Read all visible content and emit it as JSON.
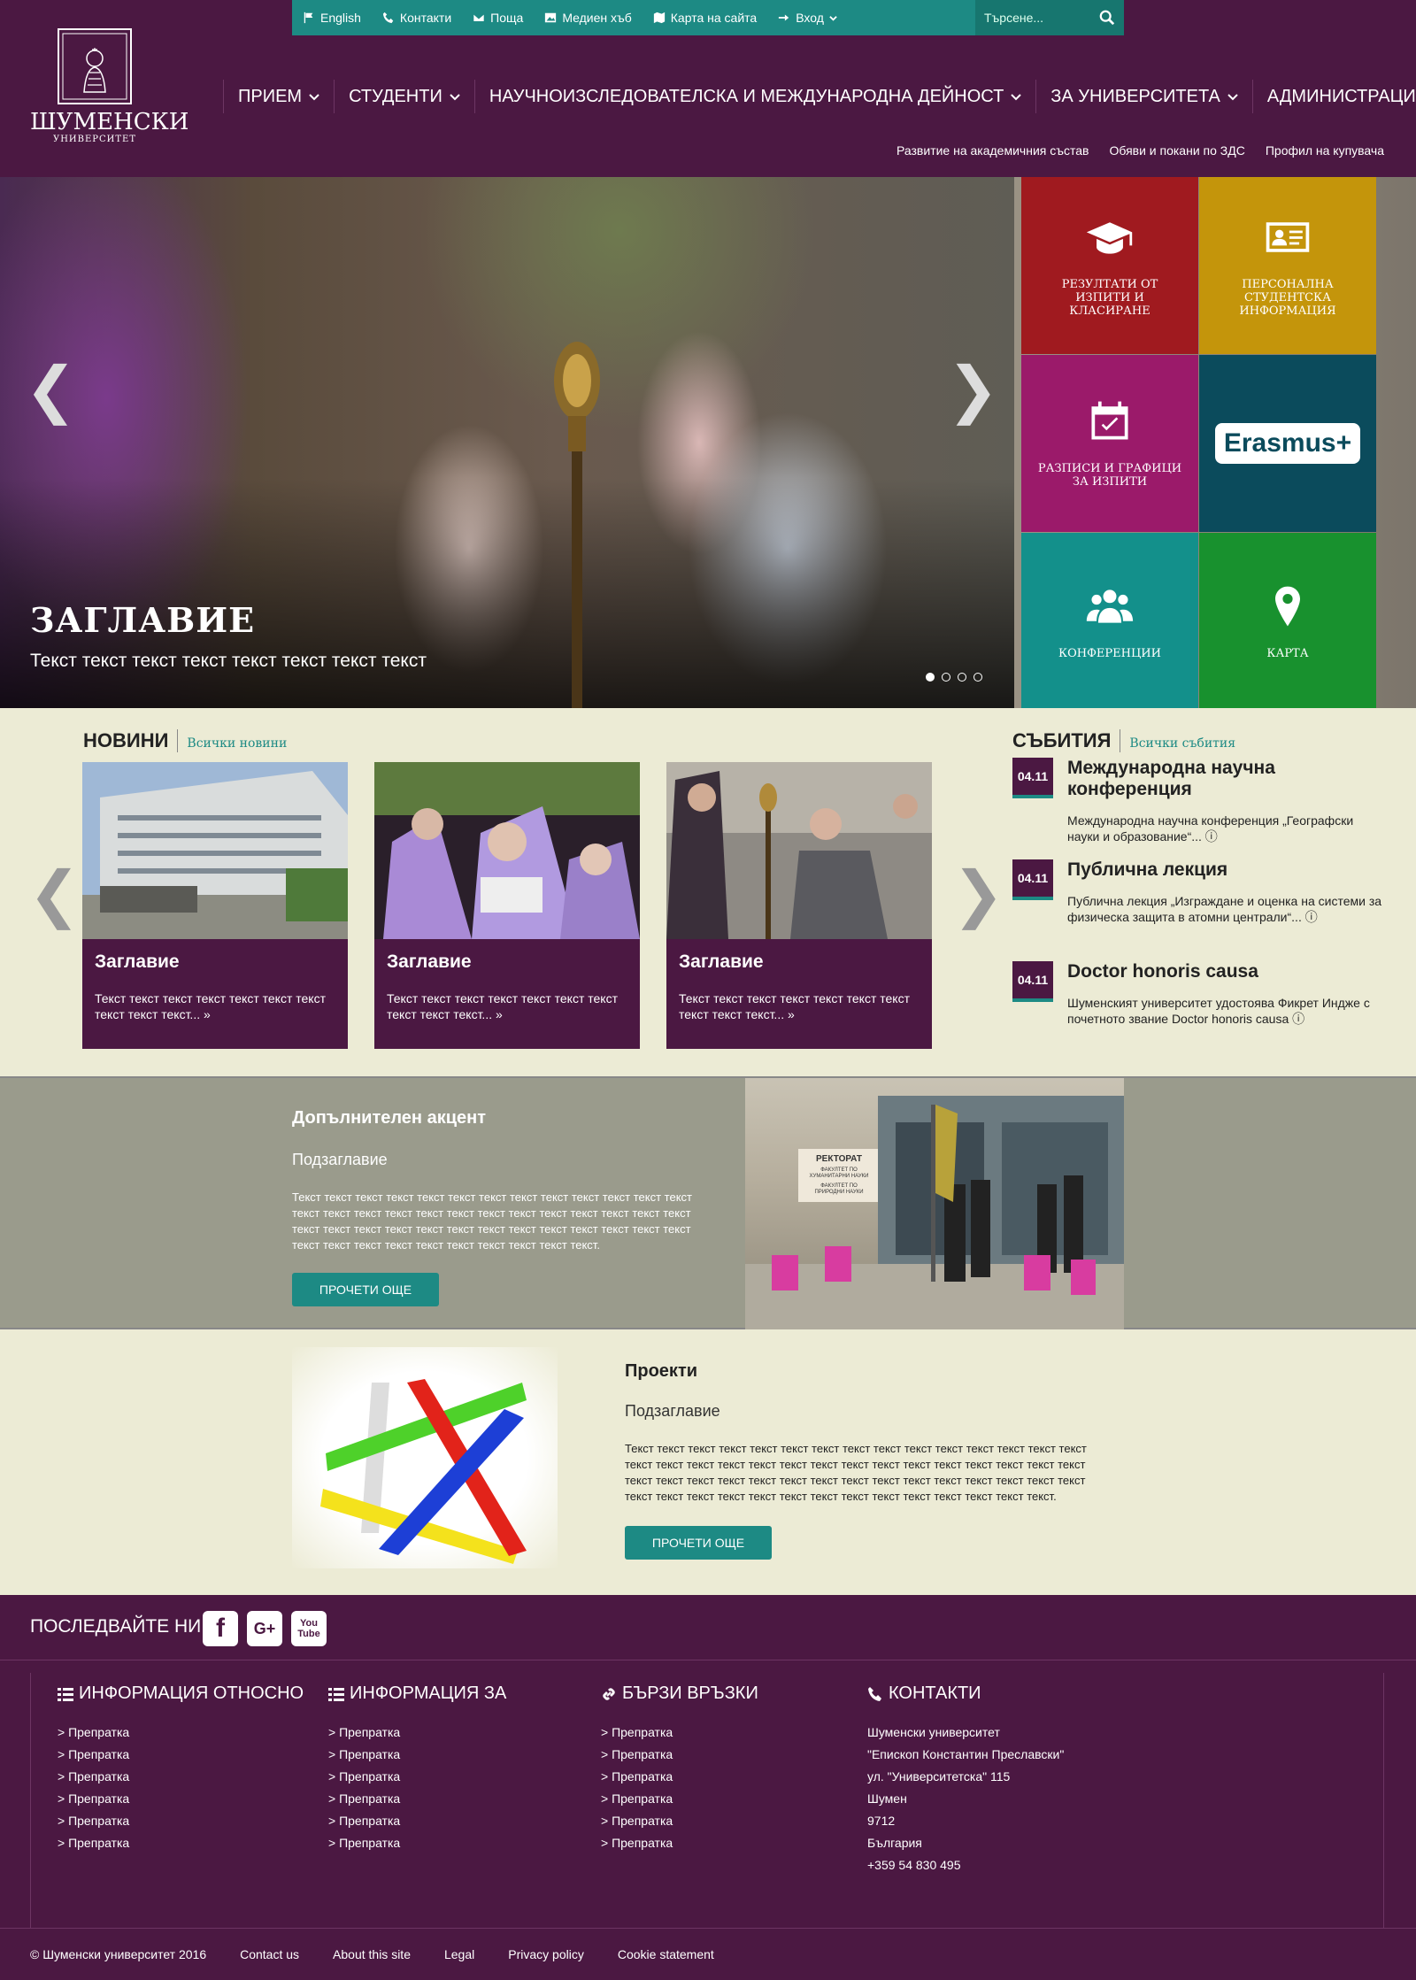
{
  "colors": {
    "brand": "#4b1842",
    "accent": "#1d8a84",
    "cream": "#ecebd5",
    "gray": "#9a9b8c"
  },
  "utility_bar": {
    "items": [
      {
        "label": "English",
        "icon": "flag-icon"
      },
      {
        "label": "Контакти",
        "icon": "phone-icon"
      },
      {
        "label": "Поща",
        "icon": "envelope-icon"
      },
      {
        "label": "Медиен хъб",
        "icon": "image-icon"
      },
      {
        "label": "Карта на сайта",
        "icon": "map-icon"
      },
      {
        "label": "Вход",
        "icon": "sign-in-icon"
      }
    ],
    "search_placeholder": "Търсене..."
  },
  "logo": {
    "seal_text": "Епископ Константин Преславски",
    "name": "ШУМЕНСКИ",
    "subtitle": "УНИВЕРСИТЕТ"
  },
  "main_nav": [
    "ПРИЕМ",
    "СТУДЕНТИ",
    "НАУЧНОИЗСЛЕДОВАТЕЛСКА И МЕЖДУНАРОДНА ДЕЙНОСТ",
    "ЗА УНИВЕРСИТЕТА",
    "АДМИНИСТРАЦИЯ"
  ],
  "secondary_nav": [
    "Развитие на академичния състав",
    "Обяви и покани по ЗДС",
    "Профил на купувача"
  ],
  "hero": {
    "title": "ЗАГЛАВИЕ",
    "subtitle": "Текст текст текст текст текст текст текст текст",
    "prev": "❮",
    "next": "❯",
    "slides": 4,
    "active_slide": 1
  },
  "tiles": [
    {
      "label": "РЕЗУЛТАТИ ОТ ИЗПИТИ И КЛАСИРАНЕ",
      "icon": "graduation-cap-icon",
      "color": "#a01a1f"
    },
    {
      "label": "ПЕРСОНАЛНА СТУДЕНТСКА ИНФОРМАЦИЯ",
      "icon": "id-card-icon",
      "color": "#c4950b"
    },
    {
      "label": "РАЗПИСИ И ГРАФИЦИ ЗА ИЗПИТИ",
      "icon": "calendar-check-icon",
      "color": "#9b1a6a"
    },
    {
      "label": "Erasmus+",
      "icon": "erasmus-logo",
      "color": "#0b4b5c"
    },
    {
      "label": "КОНФЕРЕНЦИИ",
      "icon": "users-icon",
      "color": "#13908b"
    },
    {
      "label": "КАРТА",
      "icon": "map-marker-icon",
      "color": "#18912e"
    }
  ],
  "news": {
    "heading": "НОВИНИ",
    "all_link": "Всички новини",
    "prev": "❮",
    "next": "❯",
    "cards": [
      {
        "title": "Заглавие",
        "text": "Текст текст текст текст текст текст текст текст текст текст... »"
      },
      {
        "title": "Заглавие",
        "text": "Текст текст текст текст текст текст текст текст текст текст... »"
      },
      {
        "title": "Заглавие",
        "text": "Текст текст текст текст текст текст текст текст текст текст... »"
      }
    ]
  },
  "events": {
    "heading": "СЪБИТИЯ",
    "all_link": "Всички събития",
    "items": [
      {
        "date": "04.11",
        "title": "Международна научна конференция",
        "text": "Международна научна конференция „Географски науки и образование“... ⓘ"
      },
      {
        "date": "04.11",
        "title": "Публична лекция",
        "text": "Публична лекция „Изграждане и оценка на системи за физическа защита в атомни централи“... ⓘ"
      },
      {
        "date": "04.11",
        "title": "Doctor honoris causa",
        "text": "Шуменският университет удостоява Фикрет Индже с почетното звание Doctor honoris causa ⓘ"
      }
    ]
  },
  "accent": {
    "title": "Допълнителен акцент",
    "subtitle": "Подзаглавие",
    "text": "Текст текст текст текст текст текст текст текст текст текст текст текст текст текст текст текст текст текст текст текст текст текст текст текст текст текст текст текст текст текст текст текст текст текст текст текст текст текст текст текст текст текст текст текст текст текст текст текст текст.",
    "button": "ПРОЧЕТИ ОЩЕ",
    "sign_top": "РЕКТОРАТ",
    "sign_1": "ФАКУЛТЕТ ПО ХУМАНИТАРНИ НАУКИ",
    "sign_2": "ФАКУЛТЕТ ПО ПРИРОДНИ НАУКИ"
  },
  "projects": {
    "title": "Проекти",
    "subtitle": "Подзаглавие",
    "text": "Текст текст текст текст текст текст текст текст текст текст текст текст текст текст текст текст текст текст текст текст текст текст текст текст текст текст текст текст текст текст текст текст текст текст текст текст текст текст текст текст текст текст текст текст текст текст текст текст текст текст текст текст текст текст текст текст текст текст текст.",
    "button": "ПРОЧЕТИ ОЩЕ"
  },
  "follow": {
    "label": "ПОСЛЕДВАЙТЕ НИ",
    "networks": [
      "f",
      "G+",
      "You Tube"
    ]
  },
  "footer_cols": [
    {
      "heading": "ИНФОРМАЦИЯ ОТНОСНО",
      "icon": "list-icon",
      "links": [
        "> Препратка",
        "> Препратка",
        "> Препратка",
        "> Препратка",
        "> Препратка",
        "> Препратка"
      ]
    },
    {
      "heading": "ИНФОРМАЦИЯ ЗА",
      "icon": "list-icon",
      "links": [
        "> Препратка",
        "> Препратка",
        "> Препратка",
        "> Препратка",
        "> Препратка",
        "> Препратка"
      ]
    },
    {
      "heading": "БЪРЗИ ВРЪЗКИ",
      "icon": "link-icon",
      "links": [
        "> Препратка",
        "> Препратка",
        "> Препратка",
        "> Препратка",
        "> Препратка",
        "> Препратка"
      ]
    },
    {
      "heading": "КОНТАКТИ",
      "icon": "phone-icon",
      "links": [
        "Шуменски университет",
        "\"Епископ Константин Преславски\"",
        "ул. \"Университетска\" 115",
        "Шумен",
        "9712",
        "България",
        "+359 54 830 495"
      ]
    }
  ],
  "copyright": {
    "text": "© Шуменски университет 2016",
    "links": [
      "Contact us",
      "About this site",
      "Legal",
      "Privacy policy",
      "Cookie statement"
    ]
  }
}
